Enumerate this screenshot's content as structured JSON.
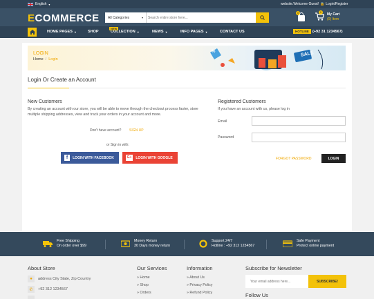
{
  "topbar": {
    "language": "English",
    "welcome": "website.Welcome Guest!",
    "login_register": "Login/Register"
  },
  "header": {
    "logo_e": "E",
    "logo_rest": "COMMERCE",
    "category_select": "All Categories",
    "search_placeholder": "Search entire store here...",
    "wishlist_count": "0",
    "cart_count": "0",
    "cart_title": "My Cart",
    "cart_items": "(0) Item"
  },
  "nav": {
    "items": [
      "HOME PAGES",
      "SHOP",
      "COLLECTION",
      "NEWS",
      "INFO PAGES",
      "CONTACT US"
    ],
    "new_badge": "NEW",
    "hotline_label": "HOTLINE",
    "hotline_number": "(+92 31 1234567)"
  },
  "breadcrumb": {
    "title": "LOGIN",
    "home": "Home",
    "separator": "/",
    "current": "Login",
    "sale_tag": "SALE",
    "percent_tag": "%"
  },
  "page": {
    "heading": "Login Or Create an Account",
    "new_customers_title": "New Customers",
    "new_customers_text": "By creating an account with our store, you will be able to move through the checkout process faster, store multiple shipping addresses, view and track your orders in your account and more.",
    "no_account": "Don't have account?",
    "signup": "SIGN UP",
    "or_sign_in": "or Sign in with:",
    "facebook": "LOGIN WITH FACEBOOK",
    "google": "LOGIN WITH GOOGLE",
    "registered_title": "Registered Customers",
    "registered_sub": "If you have an account with us, please log in",
    "email_label": "Email",
    "password_label": "Password",
    "forgot": "FORGOT PASSWORD",
    "login_btn": "LOGIN"
  },
  "services": [
    {
      "title": "Free Shipping",
      "sub": "On order over $99",
      "icon": "truck-icon"
    },
    {
      "title": "Money Return",
      "sub": "30 Days money return",
      "icon": "money-icon"
    },
    {
      "title": "Support 24/7",
      "sub": "Hotline : +92 312 1234567",
      "icon": "lifebuoy-icon"
    },
    {
      "title": "Safe Payment",
      "sub": "Protect online payment",
      "icon": "card-icon"
    }
  ],
  "footer": {
    "about_title": "About Store",
    "address": "address City State, Zip Country",
    "phone": "+92 312 1234567",
    "services_title": "Our Services",
    "services_links": [
      "Home",
      "Shop",
      "Orders"
    ],
    "info_title": "Information",
    "info_links": [
      "About Us",
      "Privacy Policy",
      "Refund Policy"
    ],
    "newsletter_title": "Subscribe for Newsletter",
    "newsletter_placeholder": "Your email address here...",
    "subscribe": "SUBSCRIBE!",
    "follow_title": "Follow Us"
  },
  "colors": {
    "accent": "#f3c20a",
    "dark": "#2f4356",
    "facebook": "#3b5a9a",
    "google": "#ea4335"
  }
}
